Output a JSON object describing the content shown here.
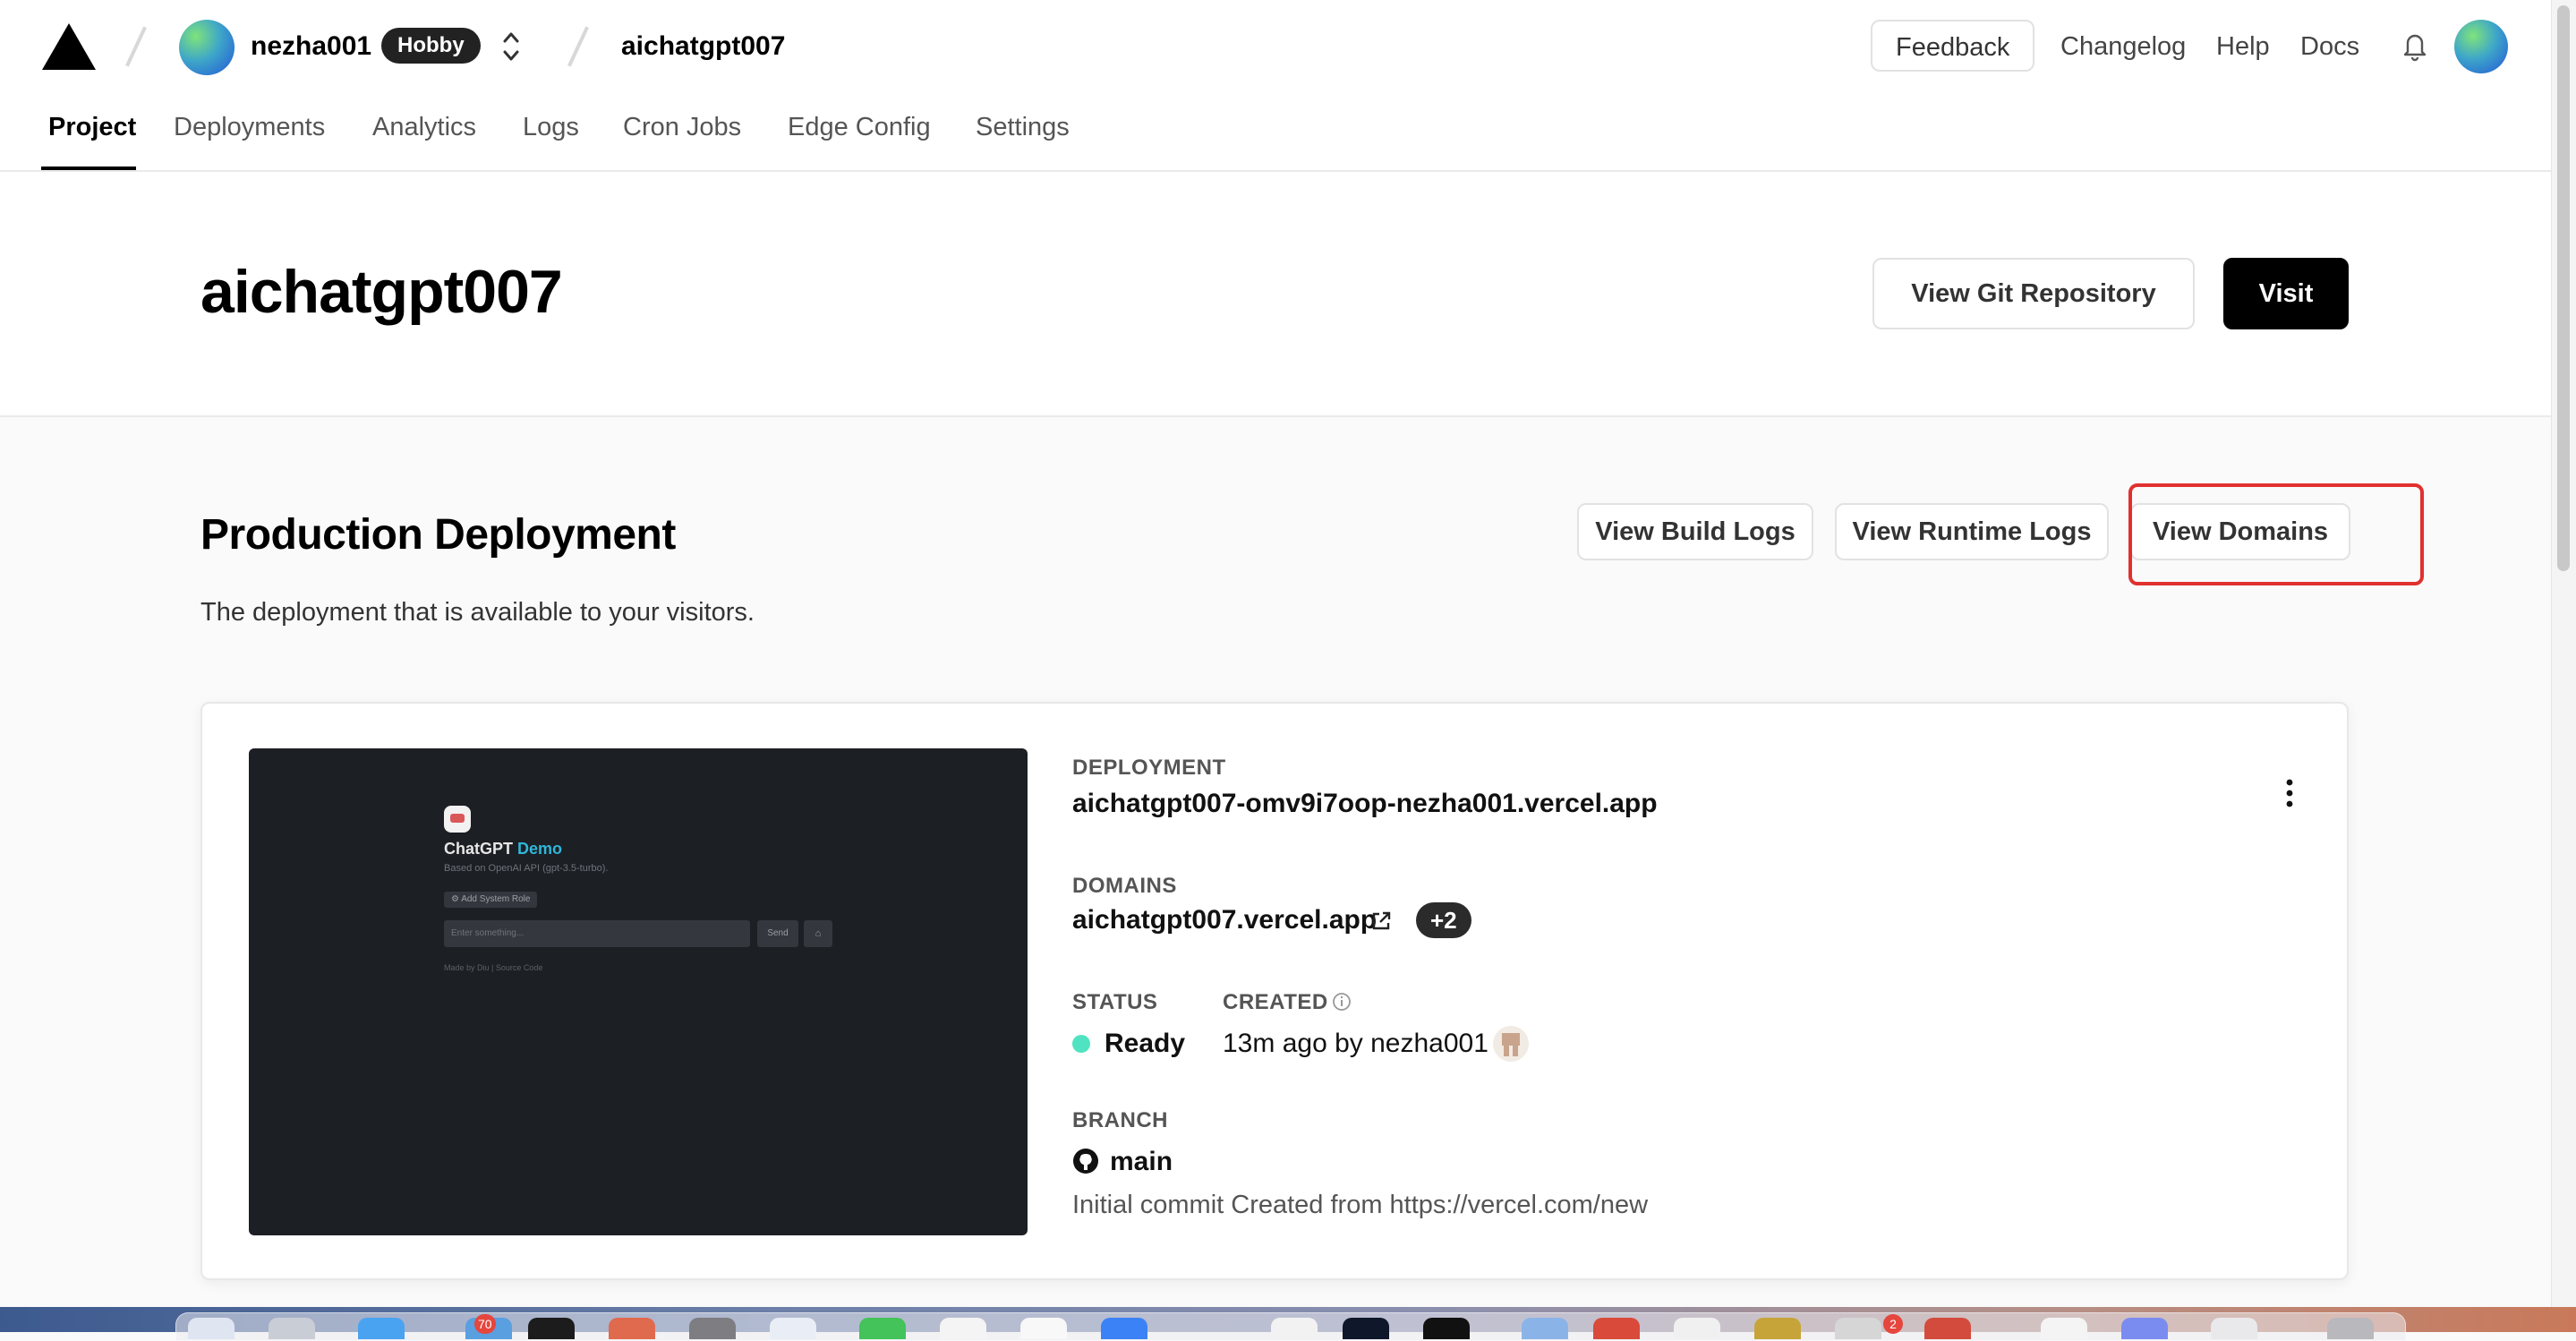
{
  "header": {
    "team_name": "nezha001",
    "plan_badge": "Hobby",
    "project_name": "aichatgpt007",
    "feedback_label": "Feedback",
    "links": [
      "Changelog",
      "Help",
      "Docs"
    ]
  },
  "tabs": [
    {
      "label": "Project",
      "active": true
    },
    {
      "label": "Deployments"
    },
    {
      "label": "Analytics"
    },
    {
      "label": "Logs"
    },
    {
      "label": "Cron Jobs"
    },
    {
      "label": "Edge Config"
    },
    {
      "label": "Settings"
    }
  ],
  "project": {
    "title": "aichatgpt007",
    "git_repo_button": "View Git Repository",
    "visit_button": "Visit"
  },
  "production": {
    "title": "Production Deployment",
    "subtitle": "The deployment that is available to your visitors.",
    "build_logs_button": "View Build Logs",
    "runtime_logs_button": "View Runtime Logs",
    "domains_button": "View Domains"
  },
  "preview": {
    "title": "ChatGPT",
    "title_accent": "Demo",
    "subtitle": "Based on OpenAI API (gpt-3.5-turbo).",
    "system_role_chip": "Add System Role",
    "input_placeholder": "Enter something...",
    "send_label": "Send",
    "footer": "Made by Diu | Source Code"
  },
  "deployment": {
    "deployment_label": "DEPLOYMENT",
    "deployment_url": "aichatgpt007-omv9i7oop-nezha001.vercel.app",
    "domains_label": "DOMAINS",
    "domain": "aichatgpt007.vercel.app",
    "extra_domains": "+2",
    "status_label": "STATUS",
    "status": "Ready",
    "status_color": "#50e3c2",
    "created_label": "CREATED",
    "created": "13m ago by nezha001",
    "branch_label": "BRANCH",
    "branch": "main",
    "commit_message": "Initial commit Created from https://vercel.com/new"
  },
  "dock": {
    "badges": [
      "70",
      "2"
    ]
  },
  "colors": {
    "highlight": "#e0312f",
    "badge_dark": "#222222"
  }
}
